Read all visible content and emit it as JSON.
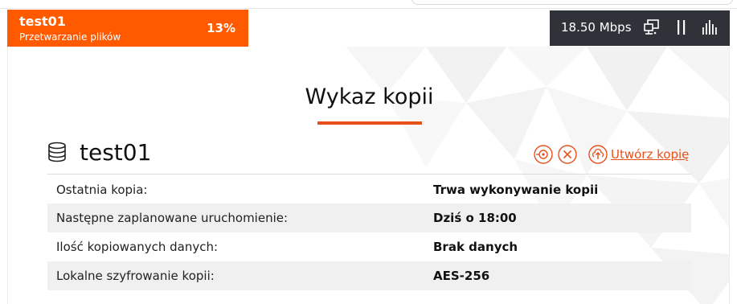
{
  "job": {
    "name": "test01",
    "status": "Przetwarzanie plików",
    "percent": "13%"
  },
  "network": {
    "speed": "18.50 Mbps",
    "icons": [
      "network-computer-icon",
      "pause-icon",
      "bar-chart-icon"
    ]
  },
  "page": {
    "title": "Wykaz kopii"
  },
  "backup": {
    "name": "test01",
    "actions": {
      "settings_icon": "disk-settings-icon",
      "cancel_icon": "cancel-circle-icon",
      "create_icon": "cloud-upload-icon",
      "create_label": "Utwórz kopię"
    },
    "rows": [
      {
        "label": "Ostatnia kopia:",
        "value": "Trwa wykonywanie kopii"
      },
      {
        "label": "Następne zaplanowane uruchomienie:",
        "value": "Dziś o 18:00"
      },
      {
        "label": "Ilość kopiowanych danych:",
        "value": "Brak danych"
      },
      {
        "label": "Lokalne szyfrowanie kopii:",
        "value": "AES-256"
      }
    ]
  },
  "colors": {
    "accent": "#ff5a00",
    "link": "#e8501b",
    "dark_bar": "#2f3339",
    "row_shade": "#f0f0f0"
  }
}
